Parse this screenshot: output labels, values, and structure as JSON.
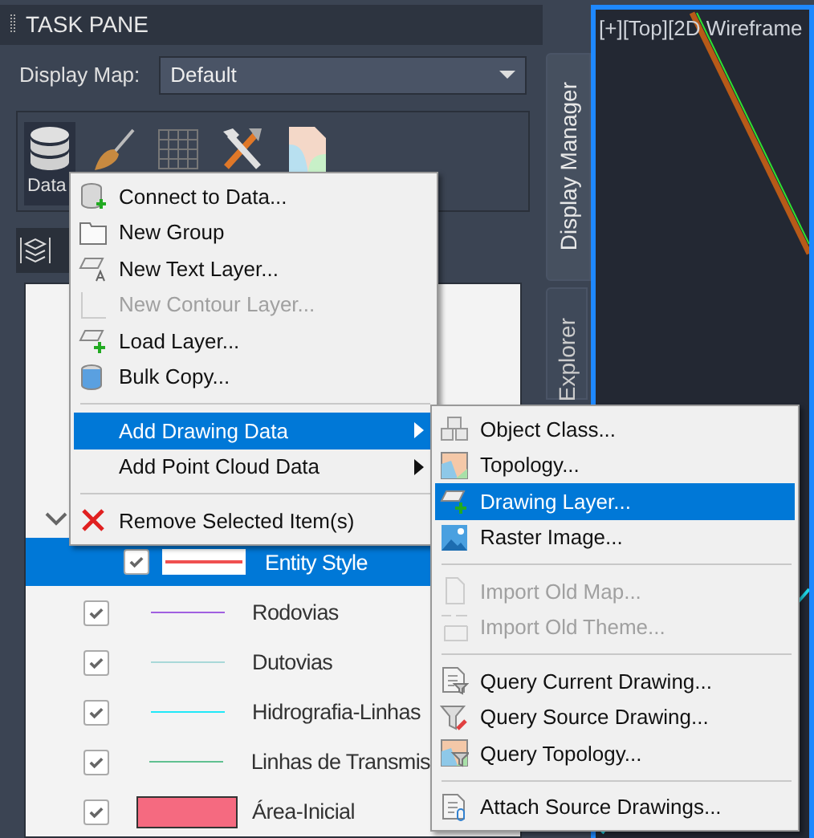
{
  "task_pane": {
    "title": "TASK PANE",
    "display_map": {
      "label": "Display Map:",
      "value": "Default"
    },
    "toolbar": [
      {
        "label": "Data",
        "selected": true
      },
      {
        "selected": false
      },
      {
        "selected": false
      },
      {
        "selected": false
      },
      {
        "selected": false
      }
    ],
    "tree": {
      "expanded": true,
      "items": [
        {
          "label": "Entity Style",
          "checked": true,
          "selected": true,
          "kind": "line",
          "color": "#f05050"
        },
        {
          "label": "Rodovias",
          "checked": true,
          "selected": false,
          "kind": "line",
          "color": "#a060e0"
        },
        {
          "label": "Dutovias",
          "checked": true,
          "selected": false,
          "kind": "line",
          "color": "#a8d8d8"
        },
        {
          "label": "Hidrografia-Linhas",
          "checked": true,
          "selected": false,
          "kind": "line",
          "color": "#20e8f8"
        },
        {
          "label": "Linhas de Transmis",
          "checked": true,
          "selected": false,
          "kind": "line",
          "color": "#60c090"
        },
        {
          "label": "Área-Inicial",
          "checked": true,
          "selected": false,
          "kind": "fill",
          "color": "#f56a80"
        }
      ]
    }
  },
  "side_tabs": [
    {
      "label": "Display Manager",
      "selected": true
    },
    {
      "label": "Explorer",
      "selected": false
    }
  ],
  "viewport": {
    "label": "[+][Top][2D Wireframe"
  },
  "context_menu": [
    {
      "kind": "item",
      "label": "Connect to Data...",
      "disabled": false,
      "selected": false,
      "has_submenu": false
    },
    {
      "kind": "item",
      "label": "New Group",
      "disabled": false,
      "selected": false,
      "has_submenu": false
    },
    {
      "kind": "item",
      "label": "New Text Layer...",
      "disabled": false,
      "selected": false,
      "has_submenu": false
    },
    {
      "kind": "item",
      "label": "New Contour Layer...",
      "disabled": true,
      "selected": false,
      "has_submenu": false
    },
    {
      "kind": "item",
      "label": "Load Layer...",
      "disabled": false,
      "selected": false,
      "has_submenu": false
    },
    {
      "kind": "item",
      "label": "Bulk Copy...",
      "disabled": false,
      "selected": false,
      "has_submenu": false
    },
    {
      "kind": "separator"
    },
    {
      "kind": "item",
      "label": "Add Drawing Data",
      "disabled": false,
      "selected": true,
      "has_submenu": true
    },
    {
      "kind": "item",
      "label": "Add Point Cloud Data",
      "disabled": false,
      "selected": false,
      "has_submenu": true
    },
    {
      "kind": "separator"
    },
    {
      "kind": "item",
      "label": "Remove Selected Item(s)",
      "disabled": false,
      "selected": false,
      "has_submenu": false
    }
  ],
  "submenu": [
    {
      "kind": "item",
      "label": "Object Class...",
      "disabled": false,
      "selected": false
    },
    {
      "kind": "item",
      "label": "Topology...",
      "disabled": false,
      "selected": false
    },
    {
      "kind": "item",
      "label": "Drawing Layer...",
      "disabled": false,
      "selected": true
    },
    {
      "kind": "item",
      "label": "Raster Image...",
      "disabled": false,
      "selected": false
    },
    {
      "kind": "separator"
    },
    {
      "kind": "item",
      "label": "Import Old Map...",
      "disabled": true,
      "selected": false
    },
    {
      "kind": "item",
      "label": "Import Old Theme...",
      "disabled": true,
      "selected": false
    },
    {
      "kind": "separator"
    },
    {
      "kind": "item",
      "label": "Query Current Drawing...",
      "disabled": false,
      "selected": false
    },
    {
      "kind": "item",
      "label": "Query Source Drawing...",
      "disabled": false,
      "selected": false
    },
    {
      "kind": "item",
      "label": "Query Topology...",
      "disabled": false,
      "selected": false
    },
    {
      "kind": "separator"
    },
    {
      "kind": "item",
      "label": "Attach Source Drawings...",
      "disabled": false,
      "selected": false
    }
  ]
}
